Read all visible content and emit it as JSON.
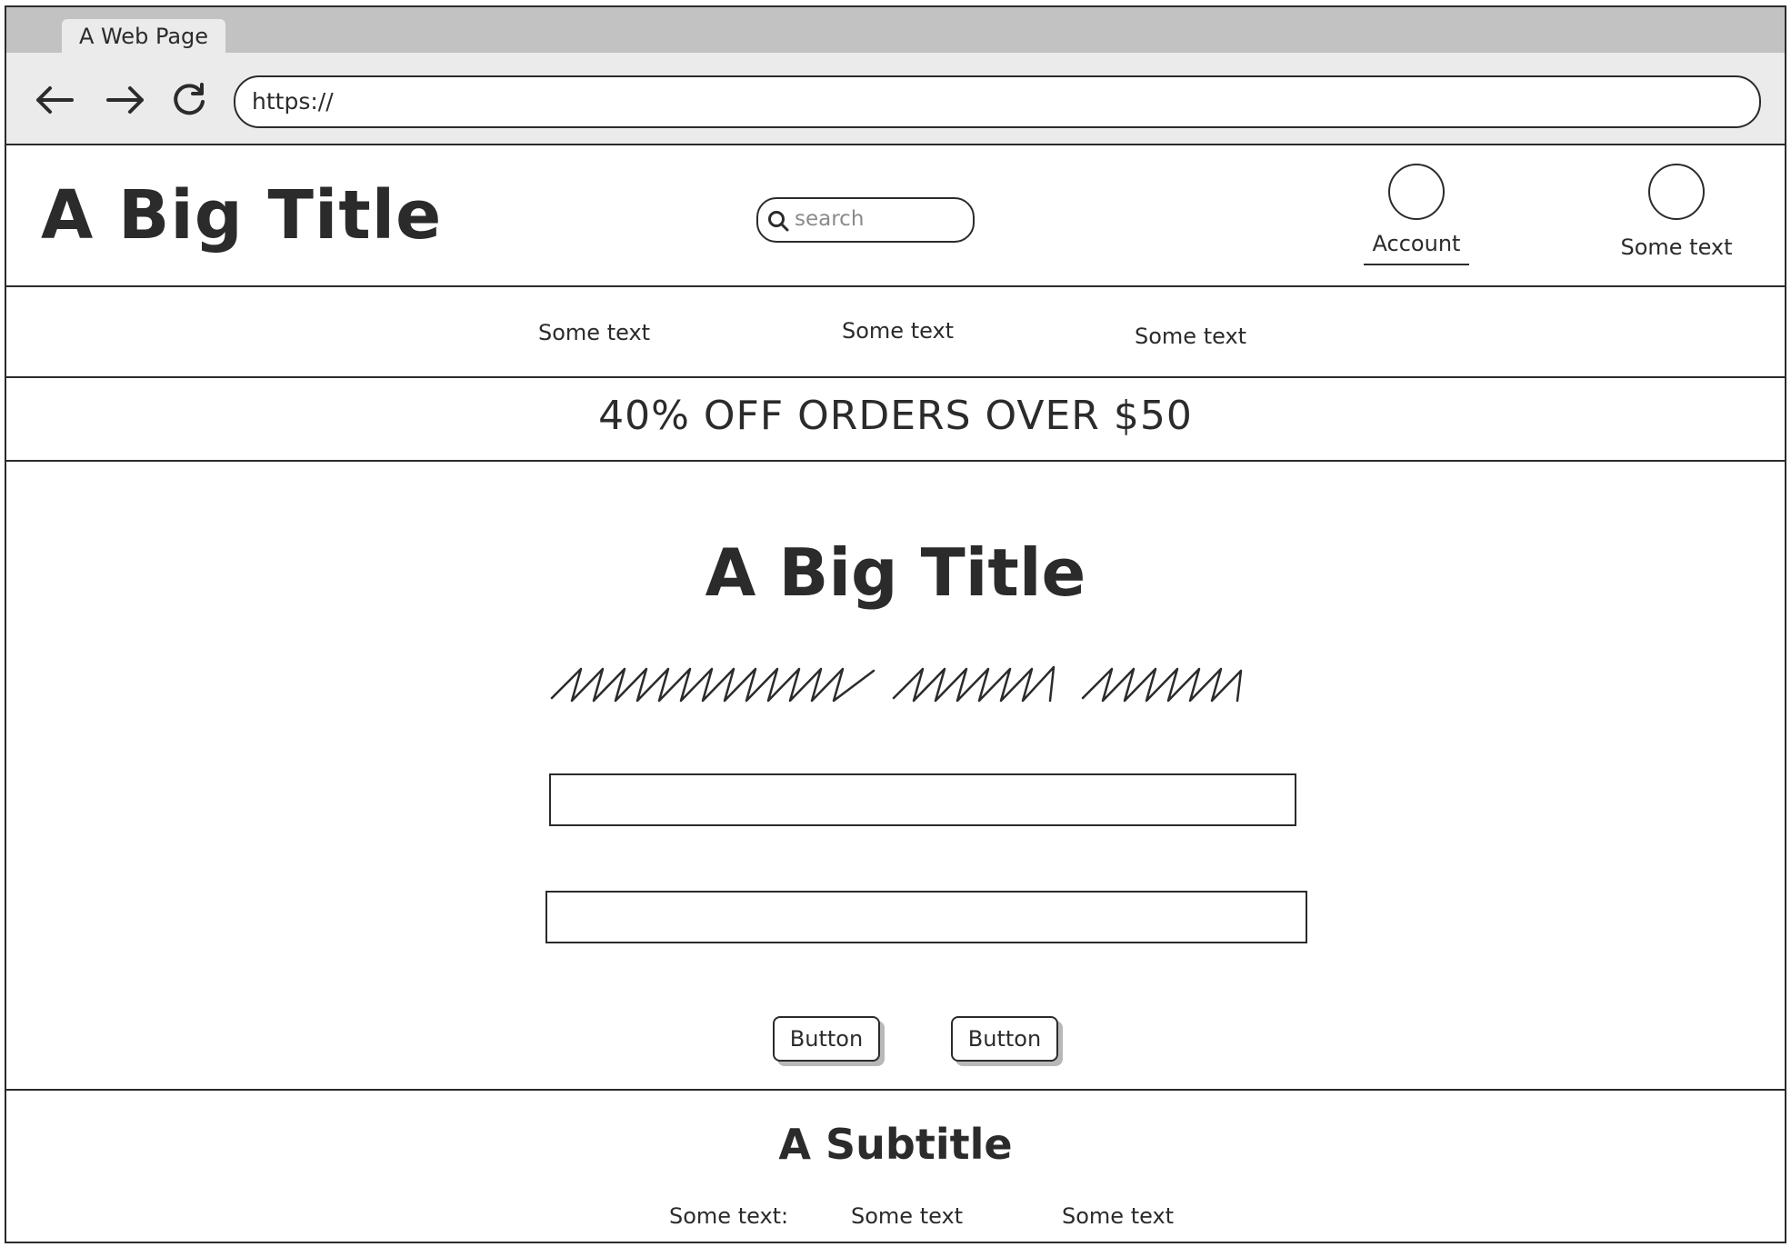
{
  "browser": {
    "tab_title": "A Web Page",
    "url": "https://",
    "back_icon": "arrow-left-icon",
    "forward_icon": "arrow-right-icon",
    "reload_icon": "reload-icon"
  },
  "header": {
    "logo": "A Big Title",
    "search_placeholder": "search",
    "search_icon": "search-icon",
    "account_label": "Account",
    "right_label": "Some text"
  },
  "nav": {
    "items": [
      "Some text",
      "Some text",
      "Some text"
    ]
  },
  "promo": {
    "text": "40% OFF ORDERS OVER $50"
  },
  "hero": {
    "title": "A Big Title",
    "field1_value": "",
    "field2_value": "",
    "buttons": [
      "Button",
      "Button"
    ]
  },
  "footer": {
    "subtitle": "A Subtitle",
    "links": [
      "Some text:",
      "Some text",
      "Some text"
    ]
  }
}
